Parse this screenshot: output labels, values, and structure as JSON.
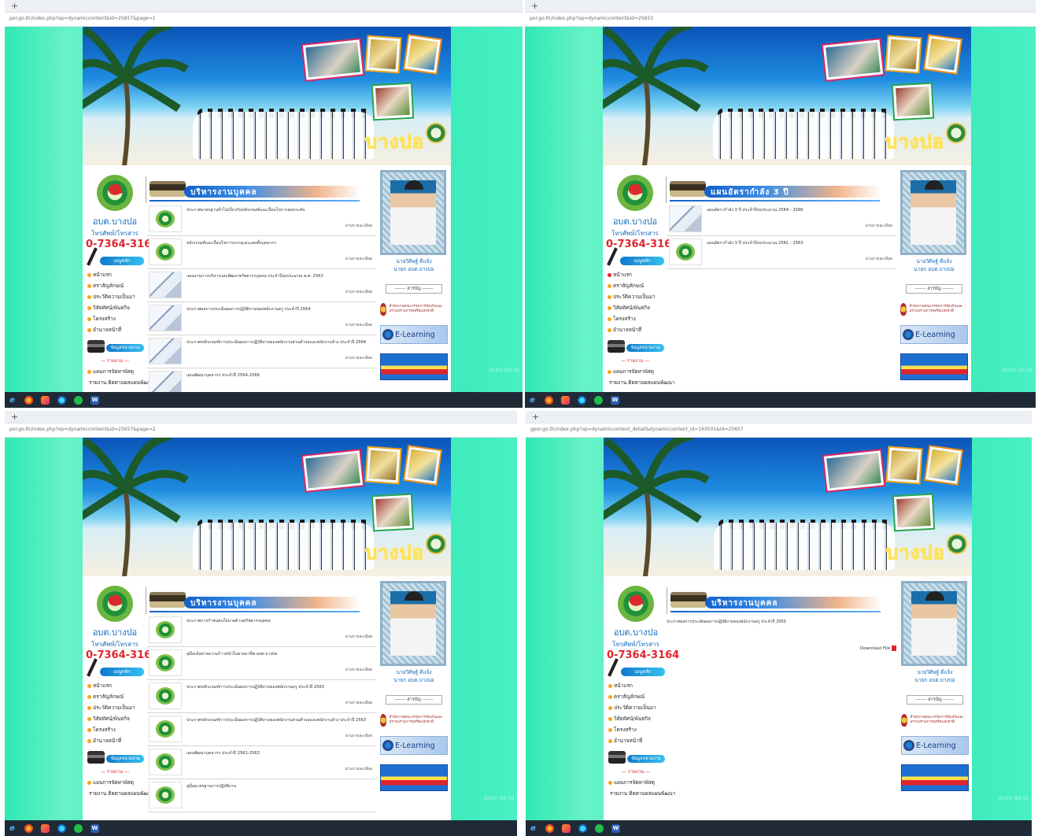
{
  "browser": {
    "new_tab": "+",
    "urls": [
      "por.go.th/index.php?op=dynamiccontent&id=25657&page=1",
      "por.go.th/index.php?op=dynamiccontent&id=25653",
      "por.go.th/index.php?op=dynamiccontent&id=25657&page=2",
      "gpor.go.th/index.php?op=dynamiccontent_detail&dynamiccontent_id=163505&id=25657"
    ]
  },
  "site": {
    "brand_name": "บางปอ",
    "org_name": "อบต.บางปอ",
    "phone_label": "โทรศัพท์/โทรสาร",
    "phone": "0-7364-3164",
    "main_menu_label": "เมนูหลัก",
    "menu": [
      "หน้าแรก",
      "ตราสัญลักษณ์",
      "ประวัติความเป็นมา",
      "วิสัยทัศน์/พันธกิจ",
      "โครงสร้าง",
      "อำนาจหน้าที่"
    ],
    "second_menu_label": "ข้อมูลหน่วยงาน",
    "report_head": "— รายงาน —",
    "report_items": [
      "แผนการจัดหาพัสดุ",
      "รายงาน ติดตามผลแผนพัฒนา"
    ],
    "mayor_name": "นายวิศิษฐ์ ดีแจ้ง",
    "mayor_title": "นายก อบต.บางปอ",
    "select_placeholder": "------- สารบัญ -------",
    "agency_text": "สำนักงานคณะกรรมการป้องกันและปราบปรามการทุจริตแห่งชาติ",
    "elearning": "E-Learning"
  },
  "panel1": {
    "title": "บริหารงานบุคคล",
    "rows": [
      "ประกาศมาตรฐานทั่วไปเกี่ยวกับหลักเกณฑ์และเงื่อนไขการสอบระดับ",
      "หลักเกณฑ์และเงื่อนไขการบรรจุและแต่งตั้งบุคลากร",
      "แผนงานการบริหารและพัฒนาทรัพยากรบุคคล ประจำปีงบประมาณ พ.ศ. 2563",
      "ประกาศผลการประเมินผลการปฏิบัติงานของพนักงานครู ประจำปี 2564",
      "ประกาศหลักเกณฑ์การประเมินผลการปฏิบัติงานของพนักงานส่วนตำบลและพนักงานจ้าง ประจำปี 2564",
      "แผนพัฒนาบุคลากร ประจำปี 2564-2566"
    ],
    "more": "อ่านรายละเอียด"
  },
  "panel2": {
    "title": "แผนอัตรากำลัง 3 ปี",
    "rows": [
      "แผนอัตรากำลัง 3 ปี ประจำปีงบประมาณ 2564 - 2566",
      "แผนอัตรากำลัง 3 ปี ประจำปีงบประมาณ 2561 - 2563"
    ],
    "more": "อ่านรายละเอียด"
  },
  "panel3": {
    "title": "บริหารงานบุคคล",
    "rows": [
      "ประกาศการกำหนดนโยบายด้านทรัพยากรบุคคล",
      "คู่มือเส้นทางความก้าวหน้าในสายอาชีพ อบต.บางปอ",
      "ประกาศหลักเกณฑ์การประเมินผลการปฏิบัติงานของพนักงานครู ประจำปี 2563",
      "ประกาศหลักเกณฑ์การประเมินผลการปฏิบัติงานของพนักงานส่วนตำบลและพนักงานจ้าง ประจำปี 2563",
      "แผนพัฒนาบุคลากร ประจำปี 2561-2563",
      "คู่มือมาตรฐานการปฏิบัติงาน"
    ],
    "more": "อ่านรายละเอียด"
  },
  "panel4": {
    "title": "บริหารงานบุคคล",
    "detail_title": "ประกาศผลการประเมินผลการปฏิบัติงานของพนักงานครู ประจำปี 2563",
    "download": "Download File"
  },
  "watermark": "Activ Go to"
}
